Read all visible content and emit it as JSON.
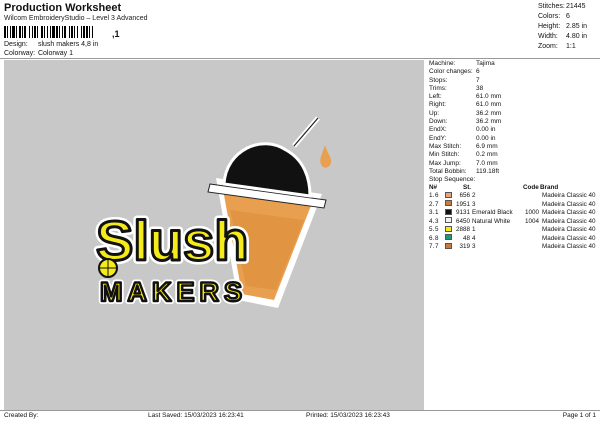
{
  "header": {
    "title": "Production Worksheet",
    "subtitle": "Wilcom EmbroideryStudio – Level 3 Advanced",
    "barcode_suffix": ",1",
    "design_label": "Design:",
    "design_value": "slush makers 4,8 in",
    "colorway_label": "Colorway:",
    "colorway_value": "Colorway 1"
  },
  "stats_top": [
    {
      "label": "Stitches:",
      "value": "21445"
    },
    {
      "label": "Colors:",
      "value": "6"
    },
    {
      "label": "Height:",
      "value": "2.85 in"
    },
    {
      "label": "Width:",
      "value": "4.80 in"
    },
    {
      "label": "Zoom:",
      "value": "1:1"
    }
  ],
  "machine_info": [
    {
      "label": "Machine:",
      "value": "Tajima"
    },
    {
      "label": "Color changes:",
      "value": "6"
    },
    {
      "label": "Stops:",
      "value": "7"
    },
    {
      "label": "Trims:",
      "value": "38"
    },
    {
      "label": "Left:",
      "value": "61.0 mm"
    },
    {
      "label": "Right:",
      "value": "61.0 mm"
    },
    {
      "label": "Up:",
      "value": "36.2 mm"
    },
    {
      "label": "Down:",
      "value": "36.2 mm"
    },
    {
      "label": "EndX:",
      "value": "0.00 in"
    },
    {
      "label": "EndY:",
      "value": "0.00 in"
    },
    {
      "label": "Max Stitch:",
      "value": "6.9 mm"
    },
    {
      "label": "Min Stitch:",
      "value": "0.2 mm"
    },
    {
      "label": "Max Jump:",
      "value": "7.0 mm"
    },
    {
      "label": "Total Bobbin:",
      "value": "119.18ft"
    }
  ],
  "stop_sequence": {
    "label": "Stop Sequence:",
    "headers": {
      "n": "N#",
      "st": "St.",
      "code": "Code",
      "brand": "Brand"
    },
    "rows": [
      {
        "a": "1.",
        "b": "6",
        "color": "#e8a47a",
        "st": "656",
        "name": "2",
        "code": "",
        "brand": "Madeira Classic 40"
      },
      {
        "a": "2.",
        "b": "7",
        "color": "#cc7a3a",
        "st": "1951",
        "name": "3",
        "code": "",
        "brand": "Madeira Classic 40"
      },
      {
        "a": "3.",
        "b": "1",
        "color": "#111111",
        "st": "9131",
        "name": "Emerald Black",
        "code": "1000",
        "brand": "Madeira Classic 40"
      },
      {
        "a": "4.",
        "b": "3",
        "color": "#f2f2f2",
        "st": "6450",
        "name": "Natural White",
        "code": "1004",
        "brand": "Madeira Classic 40"
      },
      {
        "a": "5.",
        "b": "5",
        "color": "#f5ea1a",
        "st": "2888",
        "name": "1",
        "code": "",
        "brand": "Madeira Classic 40"
      },
      {
        "a": "6.",
        "b": "8",
        "color": "#1a9a7a",
        "st": "48",
        "name": "4",
        "code": "",
        "brand": "Madeira Classic 40"
      },
      {
        "a": "7.",
        "b": "7",
        "color": "#cc7a3a",
        "st": "319",
        "name": "3",
        "code": "",
        "brand": "Madeira Classic 40"
      }
    ]
  },
  "design": {
    "word1": "Slush",
    "word2": "MAKERS",
    "colors": {
      "yellow": "#f5ea1a",
      "black": "#111111",
      "orange": "#e8a050",
      "white": "#ffffff",
      "canvas": "#c8c8c8"
    }
  },
  "footer": {
    "created": "Created By:",
    "saved": "Last Saved: 15/03/2023 16:23:41",
    "printed": "Printed: 15/03/2023 16:23:43",
    "page": "Page 1 of 1"
  }
}
